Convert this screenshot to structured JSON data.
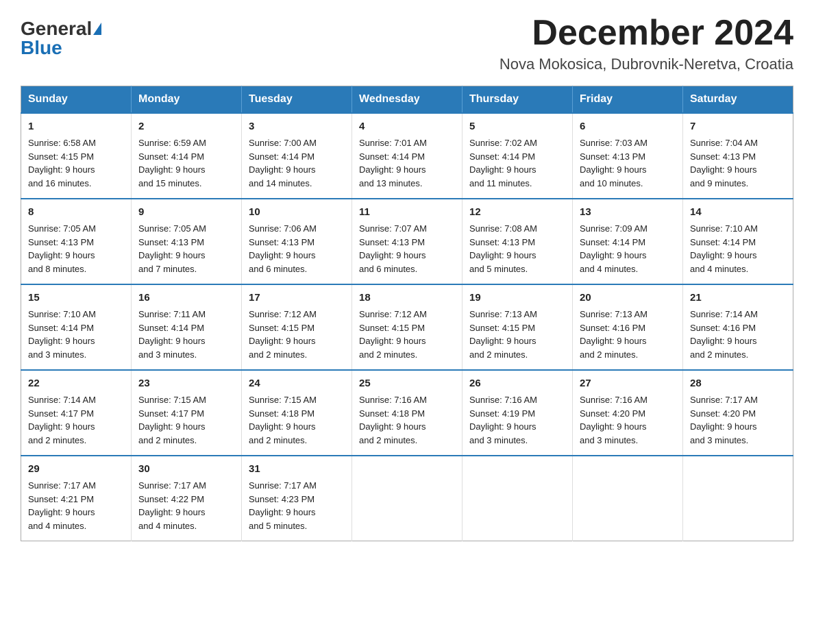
{
  "logo": {
    "general": "General",
    "blue": "Blue"
  },
  "header": {
    "month_year": "December 2024",
    "location": "Nova Mokosica, Dubrovnik-Neretva, Croatia"
  },
  "days_of_week": [
    "Sunday",
    "Monday",
    "Tuesday",
    "Wednesday",
    "Thursday",
    "Friday",
    "Saturday"
  ],
  "weeks": [
    [
      {
        "day": "1",
        "sunrise": "6:58 AM",
        "sunset": "4:15 PM",
        "daylight": "9 hours and 16 minutes."
      },
      {
        "day": "2",
        "sunrise": "6:59 AM",
        "sunset": "4:14 PM",
        "daylight": "9 hours and 15 minutes."
      },
      {
        "day": "3",
        "sunrise": "7:00 AM",
        "sunset": "4:14 PM",
        "daylight": "9 hours and 14 minutes."
      },
      {
        "day": "4",
        "sunrise": "7:01 AM",
        "sunset": "4:14 PM",
        "daylight": "9 hours and 13 minutes."
      },
      {
        "day": "5",
        "sunrise": "7:02 AM",
        "sunset": "4:14 PM",
        "daylight": "9 hours and 11 minutes."
      },
      {
        "day": "6",
        "sunrise": "7:03 AM",
        "sunset": "4:13 PM",
        "daylight": "9 hours and 10 minutes."
      },
      {
        "day": "7",
        "sunrise": "7:04 AM",
        "sunset": "4:13 PM",
        "daylight": "9 hours and 9 minutes."
      }
    ],
    [
      {
        "day": "8",
        "sunrise": "7:05 AM",
        "sunset": "4:13 PM",
        "daylight": "9 hours and 8 minutes."
      },
      {
        "day": "9",
        "sunrise": "7:05 AM",
        "sunset": "4:13 PM",
        "daylight": "9 hours and 7 minutes."
      },
      {
        "day": "10",
        "sunrise": "7:06 AM",
        "sunset": "4:13 PM",
        "daylight": "9 hours and 6 minutes."
      },
      {
        "day": "11",
        "sunrise": "7:07 AM",
        "sunset": "4:13 PM",
        "daylight": "9 hours and 6 minutes."
      },
      {
        "day": "12",
        "sunrise": "7:08 AM",
        "sunset": "4:13 PM",
        "daylight": "9 hours and 5 minutes."
      },
      {
        "day": "13",
        "sunrise": "7:09 AM",
        "sunset": "4:14 PM",
        "daylight": "9 hours and 4 minutes."
      },
      {
        "day": "14",
        "sunrise": "7:10 AM",
        "sunset": "4:14 PM",
        "daylight": "9 hours and 4 minutes."
      }
    ],
    [
      {
        "day": "15",
        "sunrise": "7:10 AM",
        "sunset": "4:14 PM",
        "daylight": "9 hours and 3 minutes."
      },
      {
        "day": "16",
        "sunrise": "7:11 AM",
        "sunset": "4:14 PM",
        "daylight": "9 hours and 3 minutes."
      },
      {
        "day": "17",
        "sunrise": "7:12 AM",
        "sunset": "4:15 PM",
        "daylight": "9 hours and 2 minutes."
      },
      {
        "day": "18",
        "sunrise": "7:12 AM",
        "sunset": "4:15 PM",
        "daylight": "9 hours and 2 minutes."
      },
      {
        "day": "19",
        "sunrise": "7:13 AM",
        "sunset": "4:15 PM",
        "daylight": "9 hours and 2 minutes."
      },
      {
        "day": "20",
        "sunrise": "7:13 AM",
        "sunset": "4:16 PM",
        "daylight": "9 hours and 2 minutes."
      },
      {
        "day": "21",
        "sunrise": "7:14 AM",
        "sunset": "4:16 PM",
        "daylight": "9 hours and 2 minutes."
      }
    ],
    [
      {
        "day": "22",
        "sunrise": "7:14 AM",
        "sunset": "4:17 PM",
        "daylight": "9 hours and 2 minutes."
      },
      {
        "day": "23",
        "sunrise": "7:15 AM",
        "sunset": "4:17 PM",
        "daylight": "9 hours and 2 minutes."
      },
      {
        "day": "24",
        "sunrise": "7:15 AM",
        "sunset": "4:18 PM",
        "daylight": "9 hours and 2 minutes."
      },
      {
        "day": "25",
        "sunrise": "7:16 AM",
        "sunset": "4:18 PM",
        "daylight": "9 hours and 2 minutes."
      },
      {
        "day": "26",
        "sunrise": "7:16 AM",
        "sunset": "4:19 PM",
        "daylight": "9 hours and 3 minutes."
      },
      {
        "day": "27",
        "sunrise": "7:16 AM",
        "sunset": "4:20 PM",
        "daylight": "9 hours and 3 minutes."
      },
      {
        "day": "28",
        "sunrise": "7:17 AM",
        "sunset": "4:20 PM",
        "daylight": "9 hours and 3 minutes."
      }
    ],
    [
      {
        "day": "29",
        "sunrise": "7:17 AM",
        "sunset": "4:21 PM",
        "daylight": "9 hours and 4 minutes."
      },
      {
        "day": "30",
        "sunrise": "7:17 AM",
        "sunset": "4:22 PM",
        "daylight": "9 hours and 4 minutes."
      },
      {
        "day": "31",
        "sunrise": "7:17 AM",
        "sunset": "4:23 PM",
        "daylight": "9 hours and 5 minutes."
      },
      null,
      null,
      null,
      null
    ]
  ],
  "labels": {
    "sunrise": "Sunrise:",
    "sunset": "Sunset:",
    "daylight": "Daylight:"
  }
}
